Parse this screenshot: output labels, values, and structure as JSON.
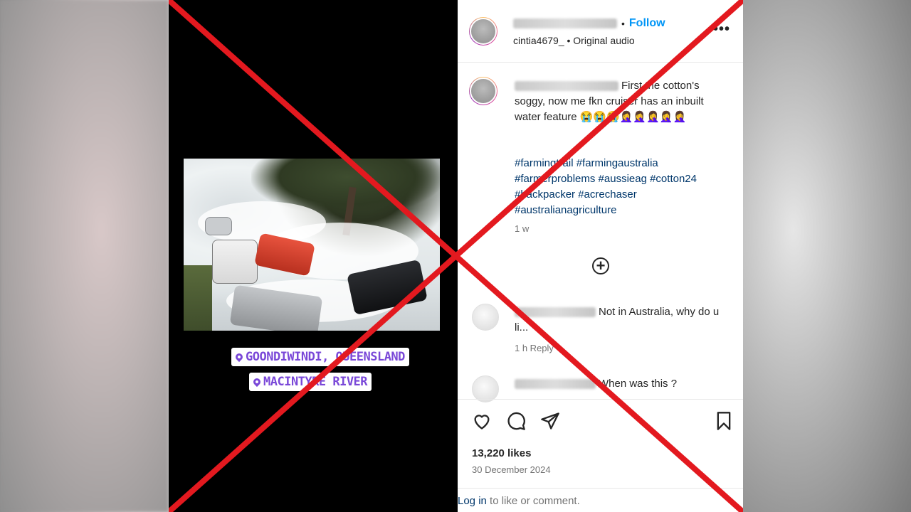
{
  "post": {
    "follow_label": "Follow",
    "audio_line": "cintia4679_ • Original audio",
    "more_icon": "more-options-icon",
    "caption_text": "First the cotton's soggy, now me fkn cruiser has an inbuilt water feature 😭😭😭🤦‍♀️🤦‍♀️🤦‍♀️🤦‍♀️🤦‍♀️",
    "hashtags": "#farmingtrail #farmingaustralia #farmerproblems #aussieag #cotton24 #backpacker #acrechaser #australianagriculture",
    "time_ago": "1 w",
    "likes": "13,220 likes",
    "date": "30 December 2024",
    "login_link": "Log in",
    "login_suffix": " to like or comment."
  },
  "comments": [
    {
      "text": "Not in Australia, why do u li...",
      "meta": "1 h   Reply"
    },
    {
      "text": "When was this ?"
    }
  ],
  "video": {
    "tag1": "GOONDIWINDI, QUEENSLAND",
    "tag2": "MACINTYRE RIVER"
  },
  "overlay": {
    "x_color": "#e3191f"
  }
}
